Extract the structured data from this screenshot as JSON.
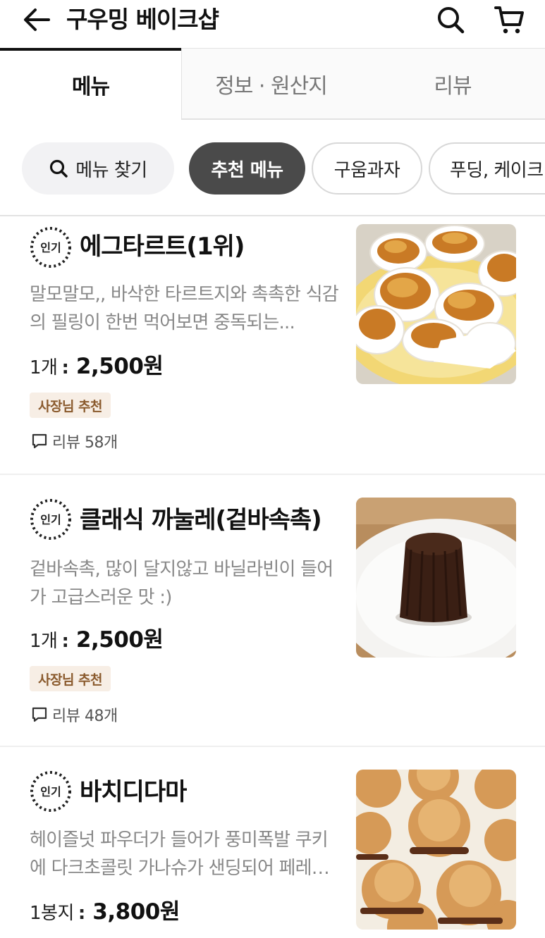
{
  "header": {
    "title": "구우밍 베이크샵",
    "icons": {
      "back": "arrow-left-icon",
      "search": "search-icon",
      "cart": "cart-icon"
    }
  },
  "tabs": [
    {
      "label": "메뉴",
      "active": true
    },
    {
      "label": "정보 · 원산지",
      "active": false
    },
    {
      "label": "리뷰",
      "active": false
    }
  ],
  "chips": {
    "search_label": "메뉴 찾기",
    "items": [
      {
        "label": "추천 메뉴",
        "selected": true
      },
      {
        "label": "구움과자",
        "selected": false
      },
      {
        "label": "푸딩, 케이크",
        "selected": false
      }
    ]
  },
  "popular_badge_text": "인기",
  "colors": {
    "selected_chip": "#4a4a4a",
    "owner_badge_bg": "#f7eee5",
    "owner_badge_text": "#8a5a2d"
  },
  "menu_items": [
    {
      "name": "에그타르트(1위)",
      "description": "말모말모,, 바삭한 타르트지와 촉촉한 식감의 필링이 한번 먹어보면 중독되는...",
      "qty_label": "1개",
      "price": "2,500원",
      "owner_badge": "사장님 추천",
      "review_label": "리뷰 58개",
      "image": "egg-tart-photo"
    },
    {
      "name": "클래식 까눌레(겉바속촉)",
      "description": "겉바속촉, 많이 달지않고 바닐라빈이 들어가 고급스러운 맛 :)",
      "qty_label": "1개",
      "price": "2,500원",
      "owner_badge": "사장님 추천",
      "review_label": "리뷰 48개",
      "image": "canele-photo"
    },
    {
      "name": "바치디다마",
      "description": "헤이즐넛 파우더가 들어가 풍미폭발 쿠키에 다크초콜릿 가나슈가 샌딩되어 페레…",
      "qty_label": "1봉지",
      "price": "3,800원",
      "image": "baci-di-dama-photo"
    }
  ]
}
